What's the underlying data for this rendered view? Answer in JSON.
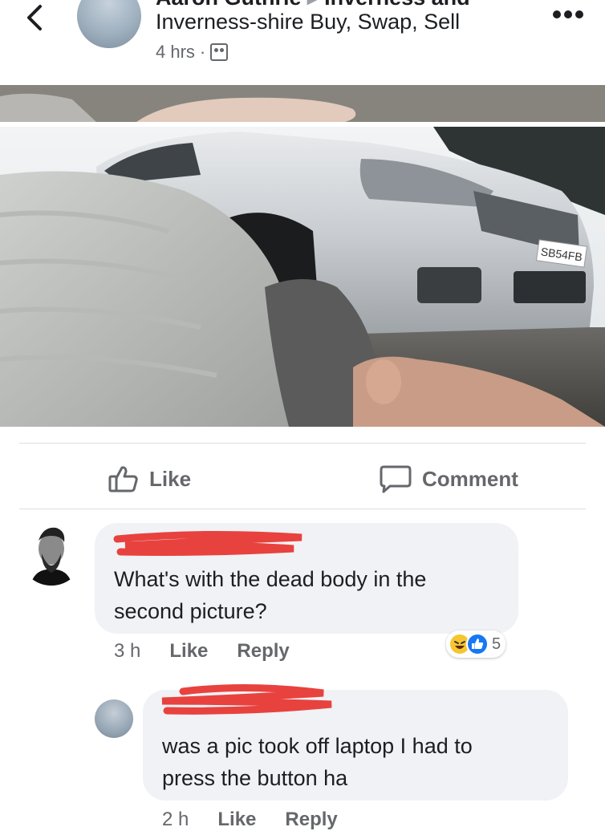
{
  "header": {
    "title_top_left": "Aaron Guthrie",
    "title_top_right": "Inverness and",
    "title": "Inverness-shire Buy, Swap, Sell",
    "time": "4 hrs",
    "separator": "·",
    "privacy_icon": "group-icon"
  },
  "photos": {
    "top_strip_desc": "cropped photo",
    "main_plate": "SB54FB"
  },
  "actions": {
    "like_label": "Like",
    "comment_label": "Comment"
  },
  "comments": [
    {
      "author_redacted": true,
      "text_line1": "What's with the dead body in the",
      "text_line2": "second picture?",
      "time": "3 h",
      "like_label": "Like",
      "reply_label": "Reply",
      "reaction_count": "5",
      "reaction_icons": [
        "haha-icon",
        "like-icon"
      ]
    },
    {
      "author_redacted": true,
      "text_line1": "was a pic took off laptop  I had to",
      "text_line2": "press the button ha",
      "time": "2 h",
      "like_label": "Like",
      "reply_label": "Reply"
    }
  ],
  "colors": {
    "text_primary": "#1c1e21",
    "text_secondary": "#65676b",
    "bubble_bg": "#f0f2f5",
    "redaction_red": "#e8423f",
    "like_blue": "#1877f2",
    "haha_yellow": "#f7c531"
  }
}
